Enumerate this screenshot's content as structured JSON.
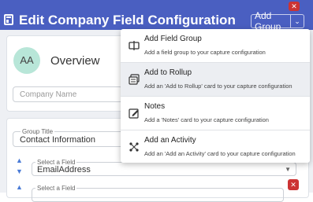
{
  "window": {
    "title": "Edit Company Field Configuration",
    "close_glyph": "✕"
  },
  "toolbar": {
    "add_group_label": "Add Group",
    "chevron": "⌄"
  },
  "overview_card": {
    "avatar_initials": "AA",
    "title": "Overview",
    "company_name_placeholder": "Company Name"
  },
  "group_card": {
    "group_title_label": "Group Title",
    "group_title_value": "Contact Information",
    "field1_label": "Select a Field",
    "field1_value": "EmailAddress",
    "field2_label": "Select a Field",
    "delete_glyph": "✕"
  },
  "menu": {
    "items": [
      {
        "title": "Add Field Group",
        "description": "Add a field group to your capture configuration",
        "icon": "field-group-icon"
      },
      {
        "title": "Add to Rollup",
        "description": "Add an 'Add to Rollup' card to your capture configuration",
        "icon": "rollup-icon"
      },
      {
        "title": "Notes",
        "description": "Add a 'Notes' card to your capture configuration",
        "icon": "notes-icon"
      },
      {
        "title": "Add an Activity",
        "description": "Add an 'Add an Activity' card to your capture configuration",
        "icon": "activity-icon"
      }
    ]
  },
  "colors": {
    "header": "#4a5fc1",
    "delete": "#cc3333",
    "avatar": "#b8e6d8"
  }
}
